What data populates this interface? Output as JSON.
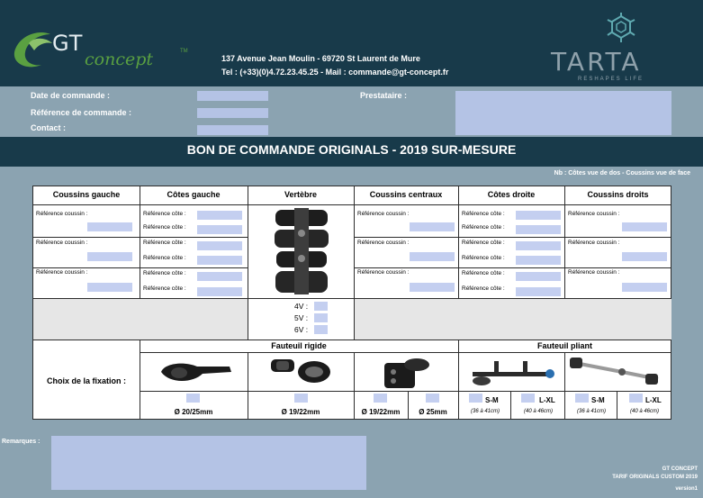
{
  "header": {
    "logo_left": {
      "gt": "GT",
      "concept": "concept",
      "tm": "TM"
    },
    "address": "137 Avenue Jean Moulin - 69720 St Laurent de Mure",
    "contact": "Tel : (+33)(0)4.72.23.45.25 - Mail : commande@gt-concept.fr",
    "logo_right": {
      "name": "TARTA",
      "tagline": "RESHAPES LIFE"
    }
  },
  "form": {
    "order_date_label": "Date de commande :",
    "order_ref_label": "Référence de commande :",
    "contact_label": "Contact :",
    "provider_label": "Prestataire :"
  },
  "title": "BON DE COMMANDE ORIGINALS - 2019    SUR-MESURE",
  "note": "Nb : Côtes vue de dos - Coussins vue de face",
  "table": {
    "columns": [
      "Coussins gauche",
      "Côtes gauche",
      "Vertèbre",
      "Coussins centraux",
      "Côtes droite",
      "Coussins droits"
    ],
    "ref_cushion": "Référence coussin :",
    "ref_rib": "Référence côte :",
    "vertebra_options": [
      "4V :",
      "5V :",
      "6V :"
    ],
    "fixation_label": "Choix de la fixation :",
    "rigid_chair": "Fauteuil rigide",
    "folding_chair": "Fauteuil pliant",
    "rigid_sizes": [
      "Ø 20/25mm",
      "Ø 19/22mm",
      "Ø 19/22mm",
      "Ø 25mm"
    ],
    "folding_sizes": [
      {
        "size": "S-M",
        "range": "(36 à 41cm)"
      },
      {
        "size": "L-XL",
        "range": "(40 à 46cm)"
      },
      {
        "size": "S-M",
        "range": "(36 à 41cm)"
      },
      {
        "size": "L-XL",
        "range": "(40 à 46cm)"
      }
    ]
  },
  "remarks_label": "Remarques :",
  "footer": {
    "line1": "GT CONCEPT",
    "line2": "TARIF ORIGINALS CUSTOM 2019",
    "line3": "version1"
  },
  "colors": {
    "header_bg": "#183a4a",
    "page_bg": "#8ba3b1",
    "field_bg": "#b4c3e5",
    "brand_green": "#5aa041"
  }
}
